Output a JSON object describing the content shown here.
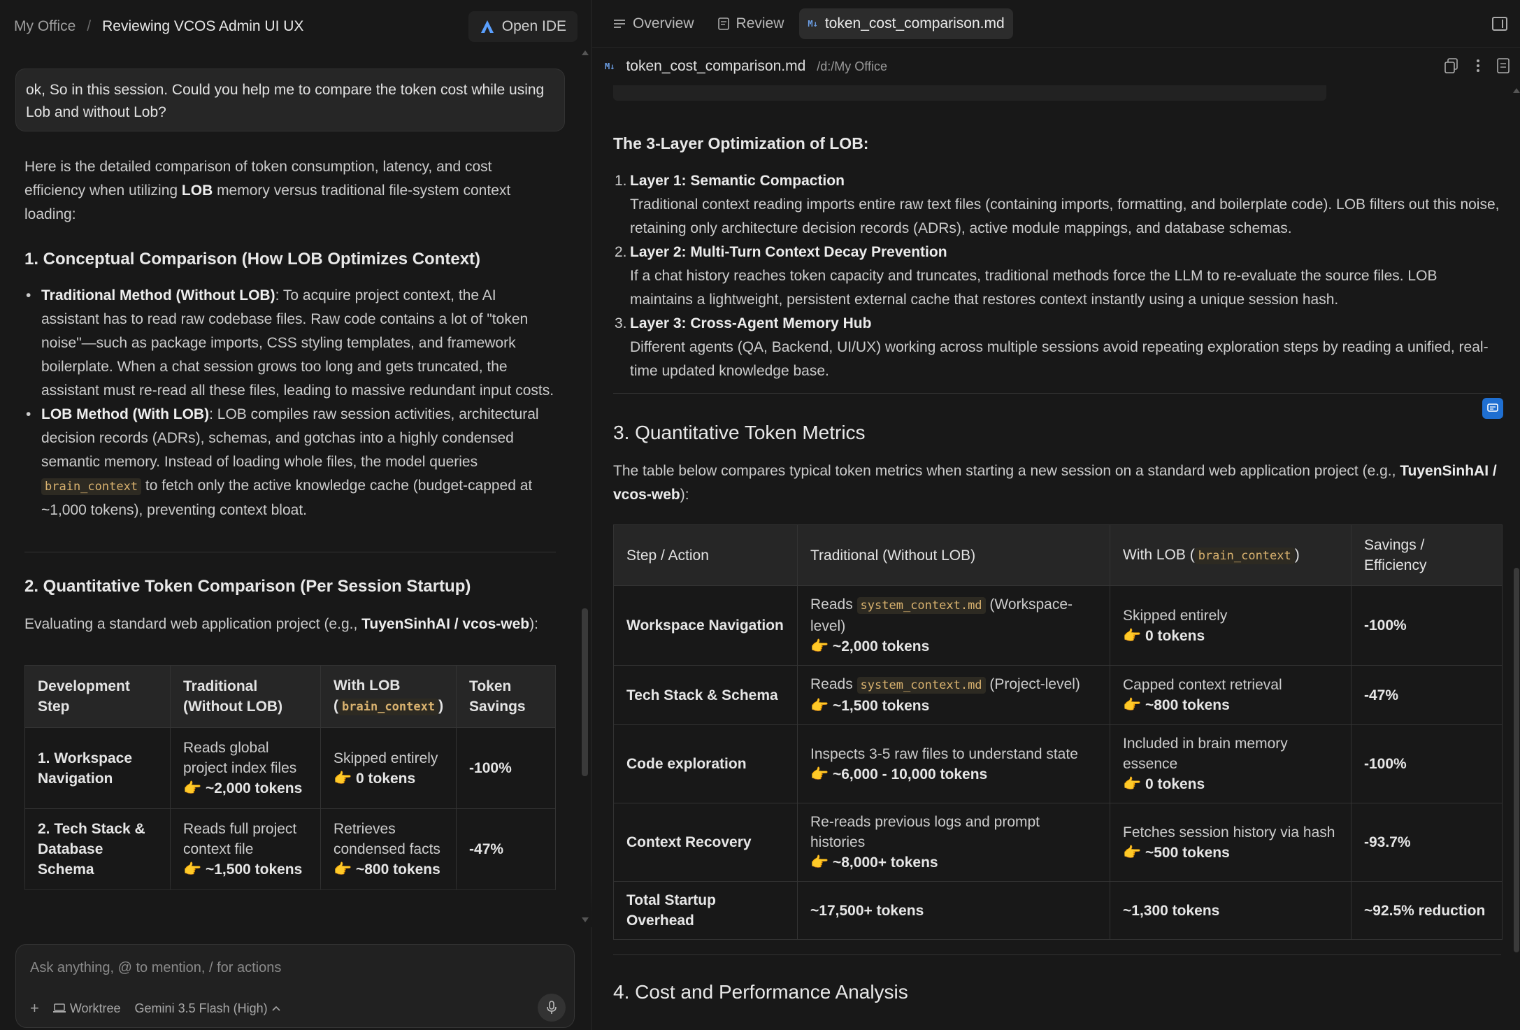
{
  "left": {
    "breadcrumb": {
      "root": "My Office",
      "separator": "/",
      "title": "Reviewing VCOS Admin UI UX"
    },
    "open_ide_label": "Open IDE",
    "user_message": "ok, So in this session. Could you help me to compare the token cost while using Lob and without Lob?",
    "intro": {
      "part1": "Here is the detailed comparison of token consumption, latency, and cost efficiency when utilizing ",
      "bold": "LOB",
      "part2": " memory versus traditional file-system context loading:"
    },
    "section1_title": "1. Conceptual Comparison (How LOB Optimizes Context)",
    "bullet1": {
      "bold": "Traditional Method (Without LOB)",
      "text": ": To acquire project context, the AI assistant has to read raw codebase files. Raw code contains a lot of \"token noise\"—such as package imports, CSS styling templates, and framework boilerplate. When a chat session grows too long and gets truncated, the assistant must re-read all these files, leading to massive redundant input costs."
    },
    "bullet2": {
      "bold": "LOB Method (With LOB)",
      "text1": ": LOB compiles raw session activities, architectural decision records (ADRs), schemas, and gotchas into a highly condensed semantic memory. Instead of loading whole files, the model queries ",
      "code": "brain_context",
      "text2": " to fetch only the active knowledge cache (budget-capped at ~1,000 tokens), preventing context bloat."
    },
    "section2_title": "2. Quantitative Token Comparison (Per Session Startup)",
    "section2_intro": {
      "part1": "Evaluating a standard web application project (e.g., ",
      "bold": "TuyenSinhAI / vcos-web",
      "part2": "):"
    },
    "table": {
      "headers": [
        "Development Step",
        "Traditional (Without LOB)",
        "With LOB (",
        "brain_context",
        ")",
        "Token Savings"
      ],
      "rows": [
        {
          "step": "1. Workspace Navigation",
          "trad": "Reads global project index files",
          "trad_tok": "👉 ~2,000 tokens",
          "lob": "Skipped entirely",
          "lob_tok": "👉 0 tokens",
          "sav": "-100%"
        },
        {
          "step": "2. Tech Stack & Database Schema",
          "trad": "Reads full project context file",
          "trad_tok": "👉 ~1,500 tokens",
          "lob": "Retrieves condensed facts",
          "lob_tok": "👉 ~800 tokens",
          "sav": "-47%"
        }
      ]
    },
    "input": {
      "placeholder": "Ask anything, @ to mention, / for actions",
      "worktree_label": "Worktree",
      "model_label": "Gemini 3.5 Flash (High)"
    }
  },
  "right": {
    "tabs": [
      {
        "label": "Overview"
      },
      {
        "label": "Review"
      },
      {
        "label": "token_cost_comparison.md"
      }
    ],
    "md_badge": "M↓",
    "file_name": "token_cost_comparison.md",
    "file_path": "/d:/My Office",
    "layers_title": "The 3-Layer Optimization of LOB:",
    "layers": [
      {
        "n": "1.",
        "title": "Layer 1: Semantic Compaction",
        "text": "Traditional context reading imports entire raw text files (containing imports, formatting, and boilerplate code). LOB filters out this noise, retaining only architecture decision records (ADRs), active module mappings, and database schemas."
      },
      {
        "n": "2.",
        "title": "Layer 2: Multi-Turn Context Decay Prevention",
        "text": "If a chat history reaches token capacity and truncates, traditional methods force the LLM to re-evaluate the source files. LOB maintains a lightweight, persistent external cache that restores context instantly using a unique session hash."
      },
      {
        "n": "3.",
        "title": "Layer 3: Cross-Agent Memory Hub",
        "text": "Different agents (QA, Backend, UI/UX) working across multiple sessions avoid repeating exploration steps by reading a unified, real-time updated knowledge base."
      }
    ],
    "section3_title": "3. Quantitative Token Metrics",
    "section3_intro": {
      "part1": "The table below compares typical token metrics when starting a new session on a standard web application project (e.g., ",
      "bold": "TuyenSinhAI / vcos-web",
      "part2": "):"
    },
    "table": {
      "headers": [
        "Step / Action",
        "Traditional (Without LOB)",
        "With LOB (",
        "brain_context",
        ")",
        "Savings / Efficiency"
      ],
      "rows": [
        {
          "step": "Workspace Navigation",
          "trad_pre": "Reads ",
          "trad_code": "system_context.md",
          "trad_post": " (Workspace-level)",
          "trad_tok": "👉 ~2,000 tokens",
          "lob": "Skipped entirely",
          "lob_tok": "👉 0 tokens",
          "sav": "-100%"
        },
        {
          "step": "Tech Stack & Schema",
          "trad_pre": "Reads ",
          "trad_code": "system_context.md",
          "trad_post": " (Project-level)",
          "trad_tok": "👉 ~1,500 tokens",
          "lob": "Capped context retrieval",
          "lob_tok": "👉 ~800 tokens",
          "sav": "-47%"
        },
        {
          "step": "Code exploration",
          "trad_pre": "Inspects 3-5 raw files to understand state",
          "trad_code": "",
          "trad_post": "",
          "trad_tok": "👉 ~6,000 - 10,000 tokens",
          "lob": "Included in brain memory essence",
          "lob_tok": "👉 0 tokens",
          "sav": "-100%"
        },
        {
          "step": "Context Recovery",
          "trad_pre": "Re-reads previous logs and prompt histories",
          "trad_code": "",
          "trad_post": "",
          "trad_tok": "👉 ~8,000+ tokens",
          "lob": "Fetches session history via hash",
          "lob_tok": "👉 ~500 tokens",
          "sav": "-93.7%"
        }
      ],
      "total": {
        "step": "Total Startup Overhead",
        "trad": "~17,500+ tokens",
        "lob": "~1,300 tokens",
        "sav": "~92.5% reduction"
      }
    },
    "section4_title": "4. Cost and Performance Analysis"
  }
}
